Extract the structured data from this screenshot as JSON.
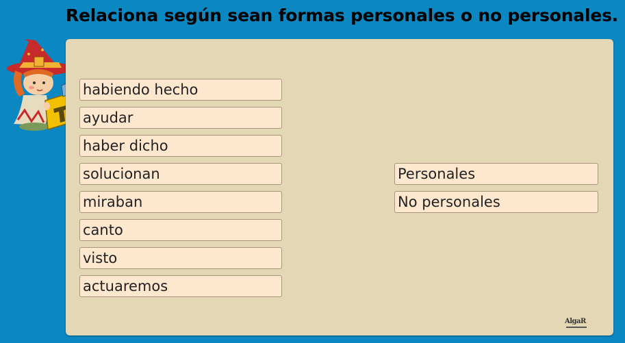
{
  "title": "Relaciona según sean formas personales o no personales.",
  "left_items": [
    {
      "label": "habiendo hecho"
    },
    {
      "label": "ayudar"
    },
    {
      "label": "haber dicho"
    },
    {
      "label": "solucionan"
    },
    {
      "label": "miraban"
    },
    {
      "label": "canto"
    },
    {
      "label": "visto"
    },
    {
      "label": "actuaremos"
    }
  ],
  "right_items": [
    {
      "label": "Personales"
    },
    {
      "label": "No personales"
    }
  ],
  "logo": "AlgaR",
  "colors": {
    "background": "#0b87c2",
    "panel": "#e4d7b5",
    "item": "#fde7ce",
    "item_border": "#a7967c"
  }
}
